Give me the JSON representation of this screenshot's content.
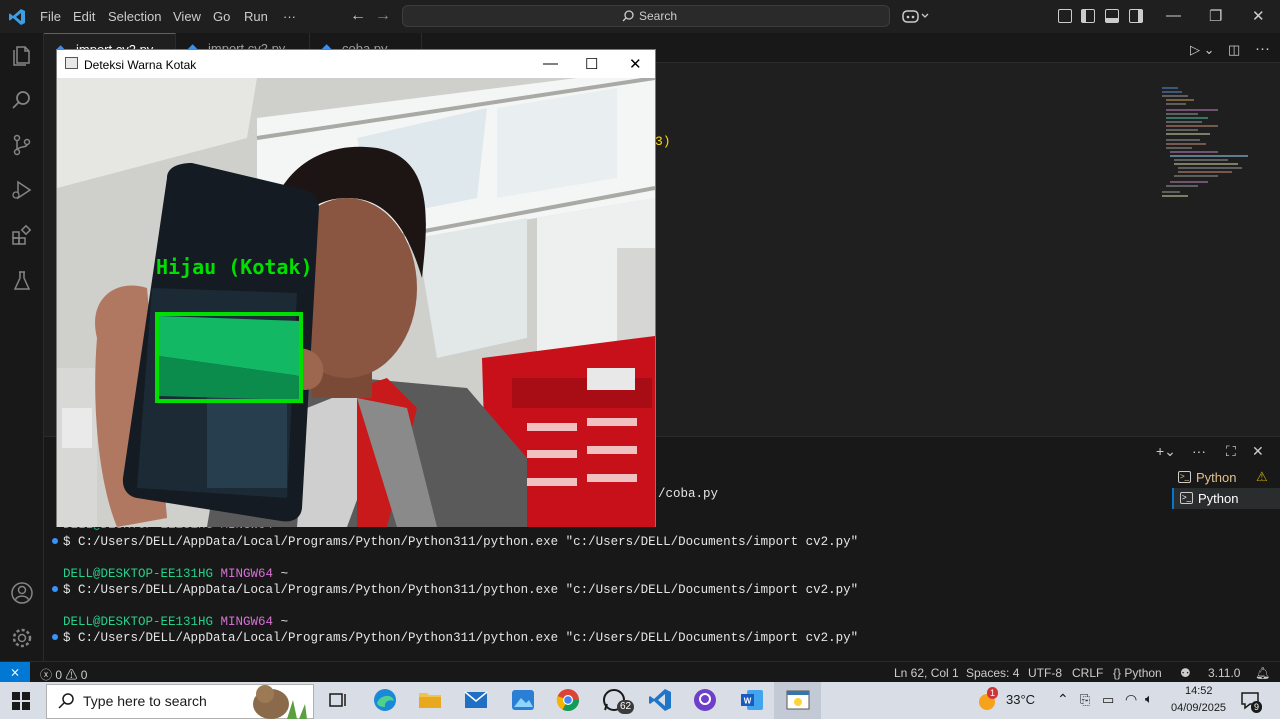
{
  "menu": [
    "File",
    "Edit",
    "Selection",
    "View",
    "Go",
    "Run",
    "···"
  ],
  "search": {
    "placeholder": "Search"
  },
  "tabs": [
    {
      "label": "import cv2.py"
    },
    {
      "label": "import cv2.py"
    },
    {
      "label": "coba.py"
    }
  ],
  "editor": {
    "code_fragment": "3)"
  },
  "cv_window": {
    "title": "Deteksi Warna Kotak",
    "detection_label": "Hijau (Kotak)"
  },
  "terminal": {
    "partial_path": "/coba.py",
    "partial_prompt": "DELL@DESKTOP-EE131HG MINGW64 ~",
    "lines": [
      {
        "cmd": "$ C:/Users/DELL/AppData/Local/Programs/Python/Python311/python.exe \"c:/Users/DELL/Documents/import cv2.py\""
      },
      {
        "user": "DELL@DESKTOP-EE131HG",
        "mingw": "MINGW64",
        "tilde": "~",
        "cmd": "$ C:/Users/DELL/AppData/Local/Programs/Python/Python311/python.exe \"c:/Users/DELL/Documents/import cv2.py\""
      },
      {
        "user": "DELL@DESKTOP-EE131HG",
        "mingw": "MINGW64",
        "tilde": "~",
        "cmd": "$ C:/Users/DELL/AppData/Local/Programs/Python/Python311/python.exe \"c:/Users/DELL/Documents/import cv2.py\""
      }
    ],
    "list": [
      {
        "label": "Python"
      },
      {
        "label": "Python"
      }
    ]
  },
  "statusbar": {
    "problems": "0",
    "warnings": "0",
    "position": "Ln 62, Col 1",
    "spaces": "Spaces: 4",
    "encoding": "UTF-8",
    "eol": "CRLF",
    "language": "Python",
    "version": "3.11.0"
  },
  "taskbar": {
    "search_placeholder": "Type here to search",
    "whatsapp_badge": "62",
    "weather_badge": "1",
    "temperature": "33°C",
    "time": "14:52",
    "date": "04/09/2025",
    "notifications": "9"
  },
  "colors": {
    "accent": "#0078d4",
    "detection_green": "#00e000",
    "terminal_user": "#23d18b",
    "terminal_mingw": "#d670d6"
  }
}
